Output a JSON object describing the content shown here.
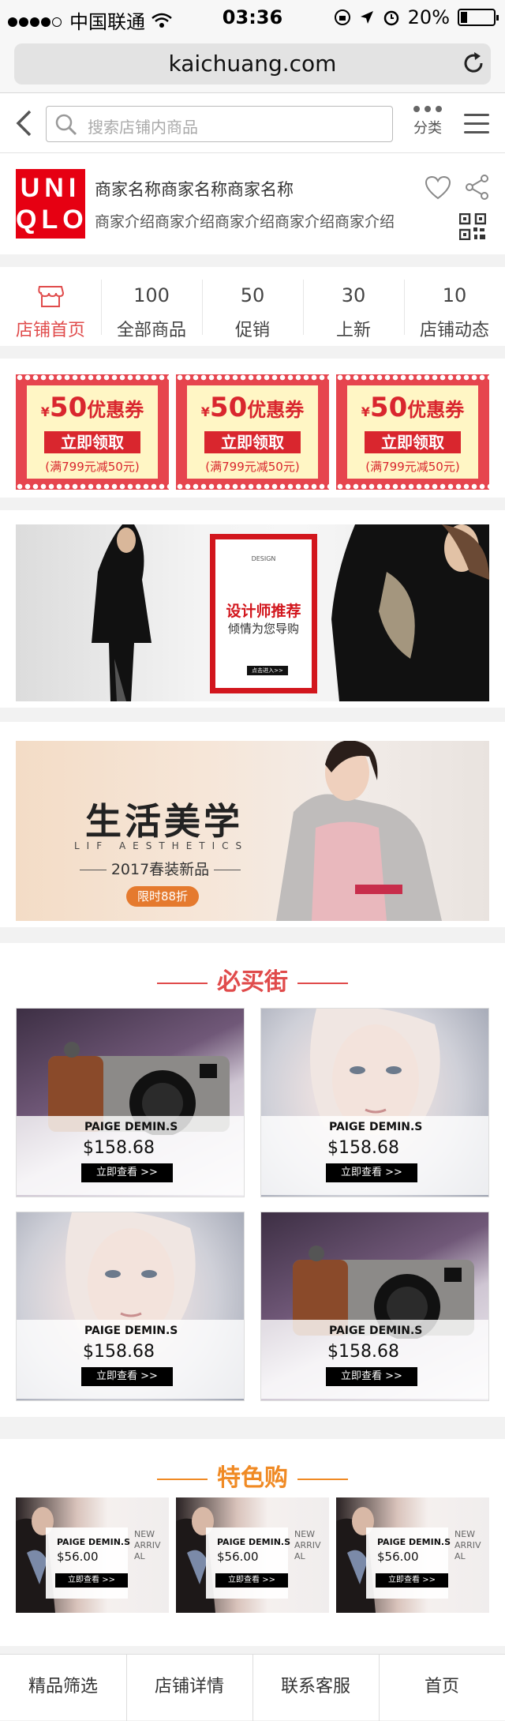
{
  "status_bar": {
    "carrier": "中国联通",
    "time": "03:36",
    "battery": "20%"
  },
  "browser": {
    "url": "kaichuang.com"
  },
  "search_bar": {
    "placeholder": "搜索店铺内商品",
    "category_label": "分类"
  },
  "shop": {
    "logo_line1": "UNI",
    "logo_line2": "QLO",
    "name": "商家名称商家名称商家名称",
    "description": "商家介绍商家介绍商家介绍商家介绍商家介绍"
  },
  "tabs": [
    {
      "count": "",
      "label": "店铺首页",
      "active": true
    },
    {
      "count": "100",
      "label": "全部商品"
    },
    {
      "count": "50",
      "label": "促销"
    },
    {
      "count": "30",
      "label": "上新"
    },
    {
      "count": "10",
      "label": "店铺动态"
    }
  ],
  "coupons": [
    {
      "currency": "¥",
      "amount": "50",
      "unit": "优惠券",
      "button": "立即领取",
      "condition": "(满799元减50元)"
    },
    {
      "currency": "¥",
      "amount": "50",
      "unit": "优惠券",
      "button": "立即领取",
      "condition": "(满799元减50元)"
    },
    {
      "currency": "¥",
      "amount": "50",
      "unit": "优惠券",
      "button": "立即领取",
      "condition": "(满799元减50元)"
    }
  ],
  "banner1": {
    "small": "DESIGN",
    "title": "设计师推荐",
    "subtitle": "倾情为您导购",
    "button": "点击进入>>"
  },
  "banner2": {
    "title": "生活美学",
    "en": "LIF AESTHETICS",
    "subtitle": "2017春装新品",
    "tag": "限时88折"
  },
  "hot_section": {
    "title": "必买街",
    "products": [
      {
        "name": "PAIGE DEMIN.S",
        "price": "$158.68",
        "button": "立即查看 >>",
        "image": "camera"
      },
      {
        "name": "PAIGE DEMIN.S",
        "price": "$158.68",
        "button": "立即查看 >>",
        "image": "woman-face"
      },
      {
        "name": "PAIGE DEMIN.S",
        "price": "$158.68",
        "button": "立即查看 >>",
        "image": "woman-face"
      },
      {
        "name": "PAIGE DEMIN.S",
        "price": "$158.68",
        "button": "立即查看 >>",
        "image": "camera"
      }
    ]
  },
  "feature_section": {
    "title": "特色购",
    "products": [
      {
        "name": "PAIGE DEMIN.S",
        "price": "$56.00",
        "button": "立即查看 >>",
        "side": "NEW ARRIVAL"
      },
      {
        "name": "PAIGE DEMIN.S",
        "price": "$56.00",
        "button": "立即查看 >>",
        "side": "NEW ARRIVAL"
      },
      {
        "name": "PAIGE DEMIN.S",
        "price": "$56.00",
        "button": "立即查看 >>",
        "side": "NEW ARRIVAL"
      }
    ]
  },
  "bottom_nav": [
    "精品筛选",
    "店铺详情",
    "联系客服",
    "首页"
  ],
  "colors": {
    "accent_red": "#e04b4b",
    "coupon_red": "#e6454e",
    "feature_orange": "#f08a24",
    "logo_red": "#e60012"
  }
}
